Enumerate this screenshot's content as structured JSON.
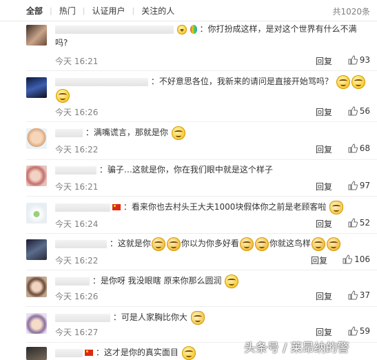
{
  "tabs": [
    {
      "label": "全部"
    },
    {
      "label": "热门"
    },
    {
      "label": "认证用户"
    },
    {
      "label": "关注的人"
    }
  ],
  "total_count": "共1020条",
  "reply_label": "回复",
  "colors": {
    "tab_active": "#333333",
    "meta_gray": "#808080",
    "divider": "#eeeeee"
  },
  "comments": [
    {
      "text": "：你打扮成这样，是对这个世界有什么不满",
      "text2": "吗?",
      "time": "今天 16:21",
      "likes": "93"
    },
    {
      "text": "：不好意思各位，我新来的请问是直接开始骂吗？",
      "time": "今天 16:26",
      "likes": "56"
    },
    {
      "text": "：满嘴谎言，那就是你",
      "time": "今天 16:22",
      "likes": "68"
    },
    {
      "text": "：骗子…这就是你，你在我们眼中就是这个样子",
      "time": "今天 16:21",
      "likes": "97"
    },
    {
      "text": "：看来你也去村头王大夫1000块假体你之前是老顾客啦",
      "time": "今天 16:24",
      "likes": "52"
    },
    {
      "text": "：这就是你",
      "text_b": "你以为你多好看",
      "text_c": "你就这鸟样",
      "time": "今天 16:22",
      "likes": "106"
    },
    {
      "text": "：是你呀 我没眼瞎 原来你那么圆润",
      "time": "今天 16:26",
      "likes": "37"
    },
    {
      "text": "：可是人家胸比你大",
      "time": "今天 16:27",
      "likes": "59"
    },
    {
      "text": "：这才是你的真实面目"
    }
  ],
  "watermark": "头条号 / 莱昂纳的警"
}
